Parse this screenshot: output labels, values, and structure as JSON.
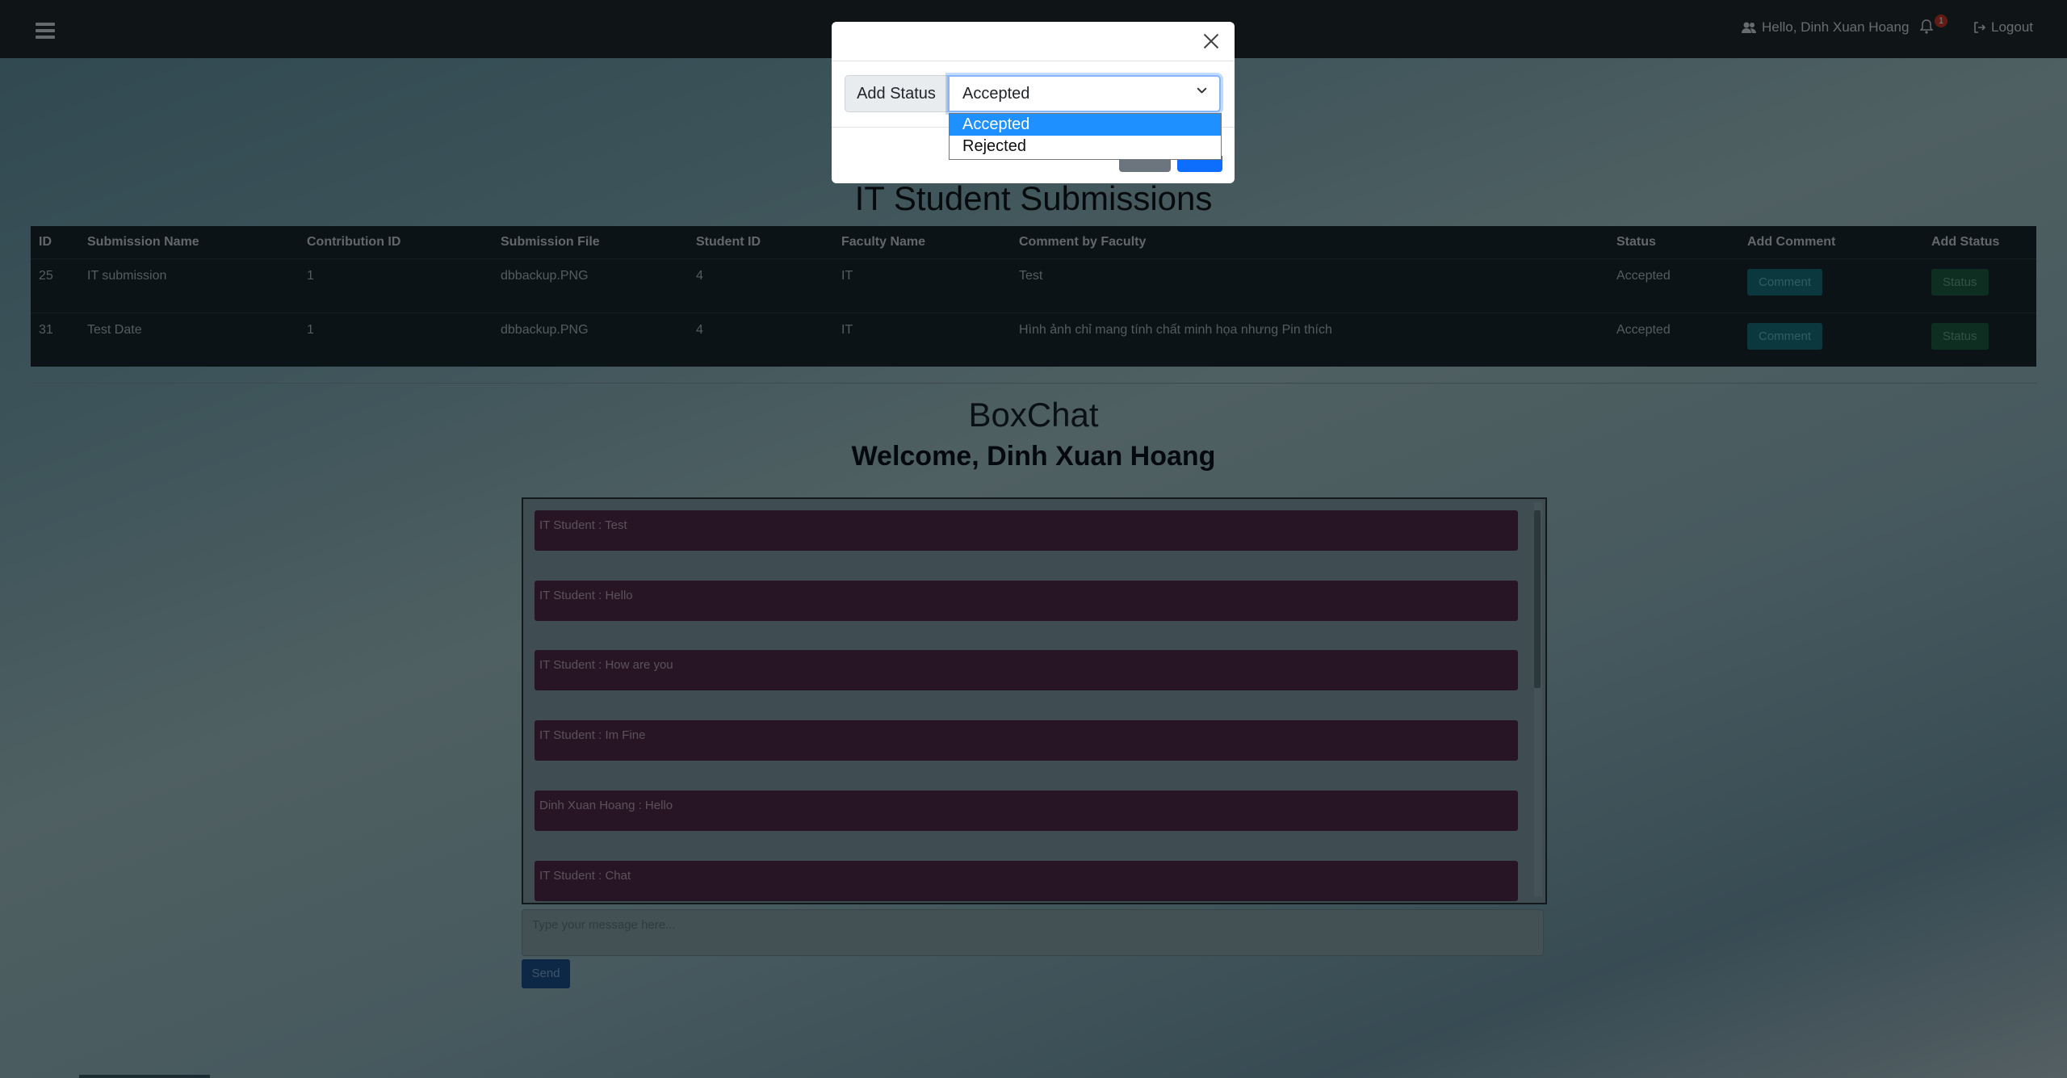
{
  "header": {
    "greeting": "Hello, Dinh Xuan Hoang",
    "notification_count": "1",
    "logout_label": "Logout"
  },
  "page_title": "IT Student Submissions",
  "table": {
    "headers": [
      "ID",
      "Submission Name",
      "Contribution ID",
      "Submission File",
      "Student ID",
      "Faculty Name",
      "Comment by Faculty",
      "Status",
      "Add Comment",
      "Add Status"
    ],
    "rows": [
      {
        "id": "25",
        "name": "IT submission",
        "contribution_id": "1",
        "file": "dbbackup.PNG",
        "student_id": "4",
        "faculty": "IT",
        "comment": "Test",
        "status": "Accepted",
        "comment_btn": "Comment",
        "status_btn": "Status"
      },
      {
        "id": "31",
        "name": "Test Date",
        "contribution_id": "1",
        "file": "dbbackup.PNG",
        "student_id": "4",
        "faculty": "IT",
        "comment": "Hình ảnh chỉ mang tính chất minh họa nhưng Pin thích",
        "status": "Accepted",
        "comment_btn": "Comment",
        "status_btn": "Status"
      }
    ]
  },
  "chat": {
    "title": "BoxChat",
    "welcome": "Welcome, Dinh Xuan Hoang",
    "messages": [
      "IT Student : Test",
      "IT Student : Hello",
      "IT Student : How are you",
      "IT Student : Im Fine",
      "Dinh Xuan Hoang : Hello",
      "IT Student : Chat"
    ],
    "input_placeholder": "Type your message here...",
    "send_label": "Send"
  },
  "modal": {
    "input_label": "Add Status",
    "selected_value": "Accepted",
    "options": [
      "Accepted",
      "Rejected"
    ]
  },
  "colors": {
    "topbar": "#1f2a2f",
    "message_bg": "#4e2a4b",
    "comment_button": "#17707f",
    "status_button": "#1f5d44",
    "send_button": "#1b4e8f",
    "dropdown_highlight": "#1e90ff"
  }
}
